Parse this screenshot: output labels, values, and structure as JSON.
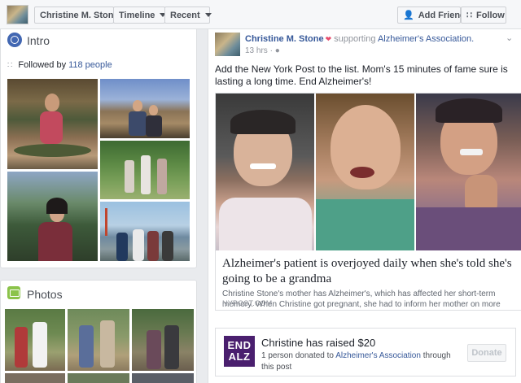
{
  "topbar": {
    "profile_name": "Christine M. Stone",
    "timeline_label": "Timeline",
    "recent_label": "Recent",
    "add_friend_label": "Add Friend",
    "follow_label": "Follow"
  },
  "intro": {
    "title": "Intro",
    "followed_prefix": "Followed by",
    "followed_count": "118 people"
  },
  "photos": {
    "title": "Photos"
  },
  "post": {
    "author": "Christine M. Stone",
    "supporting_text": "supporting",
    "organization": "Alzheimer's Association.",
    "time": "13 hrs",
    "text": "Add the New York Post to the list. Mom's 15 minutes of fame sure is lasting a long time. End Alzheimer's!",
    "link": {
      "title": "Alzheimer's patient is overjoyed daily when she's told she's going to be a grandma",
      "description": "Christine Stone's mother has Alzheimer's, which has affected her short-term memory. When Christine got pregnant, she had to inform her mother on more than one...",
      "domain": "NYPOST.COM"
    },
    "fundraiser": {
      "logo_line1": "END",
      "logo_line2": "ALZ",
      "title": "Christine has raised $20",
      "sub_prefix": "1 person donated to",
      "sub_org": "Alzheimer's Association",
      "sub_suffix": "through this post",
      "donate_label": "Donate"
    }
  },
  "colors": {
    "link_blue": "#365899",
    "brand_blue": "#4267b2",
    "endalz_purple": "#4a1f6e",
    "background": "#e9ebee"
  }
}
